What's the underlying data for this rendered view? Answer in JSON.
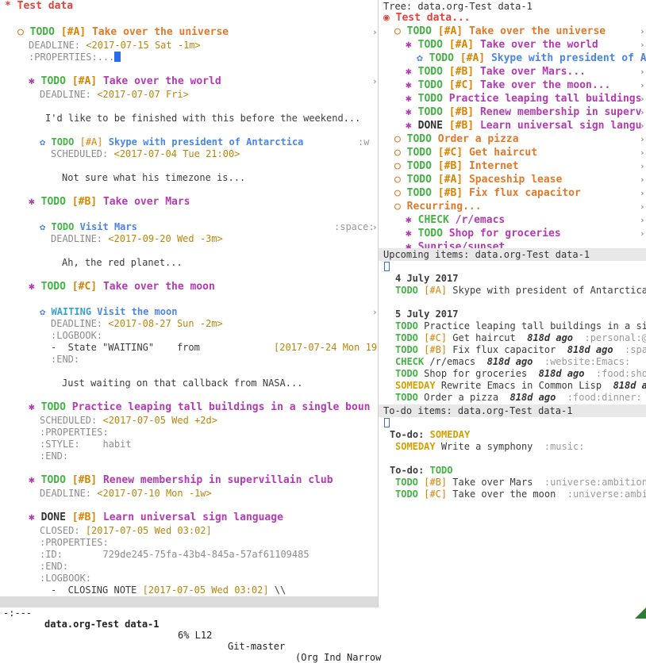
{
  "left": {
    "buffer_title": "* Test data",
    "h1": {
      "bullet": "○",
      "todo": "TODO",
      "pri": "[#A]",
      "text": "Take over the universe",
      "deadline_label": "DEADLINE:",
      "deadline": "<2017-07-15 Sat -1m>",
      "props": ":PROPERTIES:..."
    },
    "h2": {
      "bullet": "✱",
      "todo": "TODO",
      "pri": "[#A]",
      "text": "Take over the world",
      "deadline_label": "DEADLINE:",
      "deadline": "<2017-07-07 Fri>",
      "body": "I'd like to be finished with this before the weekend..."
    },
    "h3": {
      "bullet": "✿",
      "todo": "TODO",
      "pri": "[#A]",
      "text": "Skype with president of Antarctica",
      "tag": ":w",
      "sched_label": "SCHEDULED:",
      "sched": "<2017-07-04 Tue 21:00>",
      "body": "Not sure what his timezone is..."
    },
    "h4": {
      "bullet": "✱",
      "todo": "TODO",
      "pri": "[#B]",
      "text": "Take over Mars"
    },
    "h5": {
      "bullet": "✿",
      "todo": "TODO",
      "text": "Visit Mars",
      "tag": ":space:",
      "deadline_label": "DEADLINE:",
      "deadline": "<2017-09-20 Wed -3m>",
      "body": "Ah, the red planet..."
    },
    "h6": {
      "bullet": "✱",
      "todo": "TODO",
      "pri": "[#C]",
      "text": "Take over the moon"
    },
    "h7": {
      "bullet": "✿",
      "todo": "WAITING",
      "text": "Visit the moon",
      "deadline_label": "DEADLINE:",
      "deadline": "<2017-08-27 Sun -2m>",
      "logbook": ":LOGBOOK:",
      "state_line": "-  State \"WAITING\"    from",
      "state_date": "[2017-07-24 Mon 19",
      "end": ":END:",
      "body": "Just waiting on that callback from NASA..."
    },
    "h8": {
      "bullet": "✱",
      "todo": "TODO",
      "text": "Practice leaping tall buildings in a single boun",
      "sched_label": "SCHEDULED:",
      "sched": "<2017-07-05 Wed +2d>",
      "props": ":PROPERTIES:",
      "style_label": ":STYLE:",
      "style_val": "habit",
      "end": ":END:"
    },
    "h9": {
      "bullet": "✱",
      "todo": "TODO",
      "pri": "[#B]",
      "text": "Renew membership in supervillain club",
      "deadline_label": "DEADLINE:",
      "deadline": "<2017-07-10 Mon -1w>"
    },
    "h10": {
      "bullet": "✱",
      "todo": "DONE",
      "pri": "[#B]",
      "text": "Learn universal sign language",
      "closed_label": "CLOSED:",
      "closed": "[2017-07-05 Wed 03:02]",
      "props": ":PROPERTIES:",
      "id_label": ":ID:",
      "id_val": "729de245-75fa-43b4-845a-57af61109485",
      "end": ":END:",
      "logbook": ":LOGBOOK:",
      "closing_note": "-  CLOSING NOTE",
      "closing_date": "[2017-07-05 Wed 03:02]",
      "closing_tail": " \\\\"
    },
    "modeline": {
      "status": "-:---",
      "buffer": "data.org-Test data-1",
      "pos": "6% L12",
      "git": "Git-master",
      "mode": "(Org Ind Narrow"
    }
  },
  "tree": {
    "header": "Tree: data.org-Test data-1",
    "root": "Test data...",
    "items": [
      {
        "bullet": "○",
        "todo": "TODO",
        "pri": "[#A]",
        "text": "Take over the universe",
        "cls": "orange",
        "indent": 2
      },
      {
        "bullet": "✱",
        "todo": "TODO",
        "pri": "[#A]",
        "text": "Take over the world",
        "cls": "purple",
        "indent": 4
      },
      {
        "bullet": "✿",
        "todo": "TODO",
        "pri": "[#A]",
        "text": "Skype with president of Antarc",
        "cls": "blue",
        "indent": 6
      },
      {
        "bullet": "✱",
        "todo": "TODO",
        "pri": "[#B]",
        "text": "Take over Mars...",
        "cls": "purple",
        "indent": 4
      },
      {
        "bullet": "✱",
        "todo": "TODO",
        "pri": "[#C]",
        "text": "Take over the moon...",
        "cls": "purple",
        "indent": 4
      },
      {
        "bullet": "✱",
        "todo": "TODO",
        "pri": "",
        "text": "Practice leaping tall buildings",
        "cls": "purple",
        "indent": 4
      },
      {
        "bullet": "✱",
        "todo": "TODO",
        "pri": "[#B]",
        "text": "Renew membership in superv",
        "cls": "purple",
        "indent": 4
      },
      {
        "bullet": "✱",
        "todo": "DONE",
        "pri": "[#B]",
        "text": "Learn universal sign langu",
        "cls": "purple",
        "indent": 4
      },
      {
        "bullet": "○",
        "todo": "TODO",
        "pri": "",
        "text": "Order a pizza",
        "cls": "orange",
        "indent": 2
      },
      {
        "bullet": "○",
        "todo": "TODO",
        "pri": "[#C]",
        "text": "Get haircut",
        "cls": "orange",
        "indent": 2
      },
      {
        "bullet": "○",
        "todo": "TODO",
        "pri": "[#B]",
        "text": "Internet",
        "cls": "orange",
        "indent": 2
      },
      {
        "bullet": "○",
        "todo": "TODO",
        "pri": "[#A]",
        "text": "Spaceship lease",
        "cls": "orange",
        "indent": 2
      },
      {
        "bullet": "○",
        "todo": "TODO",
        "pri": "[#B]",
        "text": "Fix flux capacitor",
        "cls": "orange",
        "indent": 2
      },
      {
        "bullet": "○",
        "todo": "",
        "pri": "",
        "text": "Recurring...",
        "cls": "orange",
        "indent": 2
      },
      {
        "bullet": "✱",
        "todo": "CHECK",
        "pri": "",
        "text": "/r/emacs",
        "cls": "purple",
        "indent": 4
      },
      {
        "bullet": "✱",
        "todo": "TODO",
        "pri": "",
        "text": "Shop for groceries",
        "cls": "purple",
        "indent": 4
      },
      {
        "bullet": "✱",
        "todo": "",
        "pri": "",
        "text": "Sunrise/sunset",
        "cls": "purple",
        "indent": 4
      }
    ]
  },
  "upcoming": {
    "header": "Upcoming items: data.org-Test data-1",
    "day1": "4 July 2017",
    "day1_items": [
      {
        "todo": "TODO",
        "pri": "[#A]",
        "text": "Skype with president of Antarctica",
        "ago": "",
        "tag": ""
      }
    ],
    "day2": "5 July 2017",
    "day2_items": [
      {
        "todo": "TODO",
        "pri": "",
        "text": "Practice leaping tall buildings in a si",
        "ago": "",
        "tag": ""
      },
      {
        "todo": "TODO",
        "pri": "[#C]",
        "text": "Get haircut",
        "ago": "818d ago",
        "tag": ":personal:@"
      },
      {
        "todo": "TODO",
        "pri": "[#B]",
        "text": "Fix flux capacitor",
        "ago": "818d ago",
        "tag": ":spa"
      },
      {
        "todo": "CHECK",
        "pri": "",
        "text": "/r/emacs",
        "ago": "818d ago",
        "tag": ":website:Emacs:"
      },
      {
        "todo": "TODO",
        "pri": "",
        "text": "Shop for groceries",
        "ago": "818d ago",
        "tag": ":food:sho"
      },
      {
        "todo": "SOMEDAY",
        "pri": "",
        "text": "Rewrite Emacs in Common Lisp",
        "ago": "818d a",
        "tag": ""
      },
      {
        "todo": "TODO",
        "pri": "",
        "text": "Order a pizza",
        "ago": "818d ago",
        "tag": ":food:dinner:"
      }
    ]
  },
  "todo": {
    "header": "To-do items: data.org-Test data-1",
    "group1": "To-do:",
    "group1_kw": "SOMEDAY",
    "group1_items": [
      {
        "todo": "SOMEDAY",
        "pri": "",
        "text": "Write a symphony",
        "tag": ":music:"
      }
    ],
    "group2": "To-do:",
    "group2_kw": "TODO",
    "group2_items": [
      {
        "todo": "TODO",
        "pri": "[#B]",
        "text": "Take over Mars",
        "tag": ":universe:ambition"
      },
      {
        "todo": "TODO",
        "pri": "[#C]",
        "text": "Take over the moon",
        "tag": ":universe:ambi"
      }
    ]
  },
  "colors": {
    "todo": "#44b244",
    "orange": "#e07a2a",
    "purple": "#b33ab3",
    "blue": "#4a86e8",
    "red": "#e0443e"
  }
}
